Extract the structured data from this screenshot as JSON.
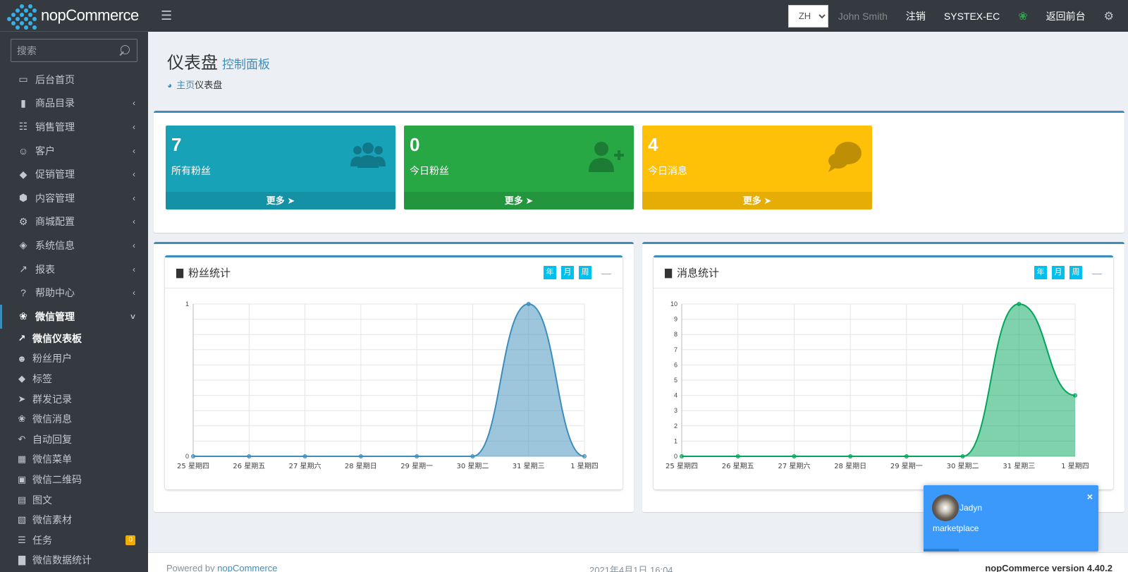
{
  "brand": {
    "name": "nopCommerce"
  },
  "search": {
    "placeholder": "搜索"
  },
  "nav": [
    {
      "label": "后台首页",
      "icon": "monitor-icon",
      "chev": false
    },
    {
      "label": "商品目录",
      "icon": "book-icon",
      "chev": true
    },
    {
      "label": "销售管理",
      "icon": "cart-icon",
      "chev": true
    },
    {
      "label": "客户",
      "icon": "user-icon",
      "chev": true
    },
    {
      "label": "促销管理",
      "icon": "tags-icon",
      "chev": true
    },
    {
      "label": "内容管理",
      "icon": "cubes-icon",
      "chev": true
    },
    {
      "label": "商城配置",
      "icon": "gears-icon",
      "chev": true
    },
    {
      "label": "系统信息",
      "icon": "cube-icon",
      "chev": true
    },
    {
      "label": "报表",
      "icon": "line-chart-icon",
      "chev": true
    },
    {
      "label": "帮助中心",
      "icon": "question-icon",
      "chev": true
    },
    {
      "label": "微信管理",
      "icon": "wechat-icon",
      "chev": true
    }
  ],
  "subnav": [
    {
      "label": "微信仪表板",
      "icon": "line-chart-icon"
    },
    {
      "label": "粉丝用户",
      "icon": "users-icon"
    },
    {
      "label": "标签",
      "icon": "tags-icon"
    },
    {
      "label": "群发记录",
      "icon": "paper-plane-icon"
    },
    {
      "label": "微信消息",
      "icon": "wechat-icon"
    },
    {
      "label": "自动回复",
      "icon": "reply-icon"
    },
    {
      "label": "微信菜单",
      "icon": "th-icon"
    },
    {
      "label": "微信二维码",
      "icon": "qrcode-icon"
    },
    {
      "label": "图文",
      "icon": "newspaper-icon"
    },
    {
      "label": "微信素材",
      "icon": "images-icon"
    },
    {
      "label": "任务",
      "icon": "list-icon",
      "badge": "0"
    },
    {
      "label": "微信数据统计",
      "icon": "bar-chart-icon"
    }
  ],
  "header": {
    "lang": "ZH",
    "user": "John Smith",
    "logout": "注销",
    "store": "SYSTEX-EC",
    "back": "返回前台"
  },
  "page": {
    "title": "仪表盘",
    "subtitle": "控制面板",
    "breadcrumb_home": "主页",
    "breadcrumb_current": "仪表盘"
  },
  "boxes": [
    {
      "value": "7",
      "label": "所有粉丝",
      "more": "更多",
      "color": "#17a2b8"
    },
    {
      "value": "0",
      "label": "今日粉丝",
      "more": "更多",
      "color": "#28a745"
    },
    {
      "value": "4",
      "label": "今日消息",
      "more": "更多",
      "color": "#ffc107"
    }
  ],
  "charts": {
    "fans_title": "粉丝统计",
    "msg_title": "消息统计",
    "btn_year": "年",
    "btn_month": "月",
    "btn_week": "周"
  },
  "chart_data": [
    {
      "type": "area",
      "title": "粉丝统计",
      "categories": [
        "25 星期四",
        "26 星期五",
        "27 星期六",
        "28 星期日",
        "29 星期一",
        "30 星期二",
        "31 星期三",
        "1 星期四"
      ],
      "values": [
        0,
        0,
        0,
        0,
        0,
        0,
        1,
        0
      ],
      "ylim": [
        0,
        1
      ],
      "yticks": [
        0,
        1
      ],
      "color": "#3c8dbc",
      "grid": true
    },
    {
      "type": "area",
      "title": "消息统计",
      "categories": [
        "25 星期四",
        "26 星期五",
        "27 星期六",
        "28 星期日",
        "29 星期一",
        "30 星期二",
        "31 星期三",
        "1 星期四"
      ],
      "values": [
        0,
        0,
        0,
        0,
        0,
        0,
        10,
        4
      ],
      "ylim": [
        0,
        10
      ],
      "yticks": [
        0,
        1,
        2,
        3,
        4,
        5,
        6,
        7,
        8,
        9,
        10
      ],
      "color": "#00a65a",
      "grid": true
    }
  ],
  "footer": {
    "powered": "Powered by",
    "powered_link": "nopCommerce",
    "datetime": "2021年4月1日 16:04",
    "version": "nopCommerce version 4.40.2"
  },
  "toast": {
    "name": "Jadyn",
    "message": "marketplace",
    "close": "×",
    "progress": 0.2
  }
}
